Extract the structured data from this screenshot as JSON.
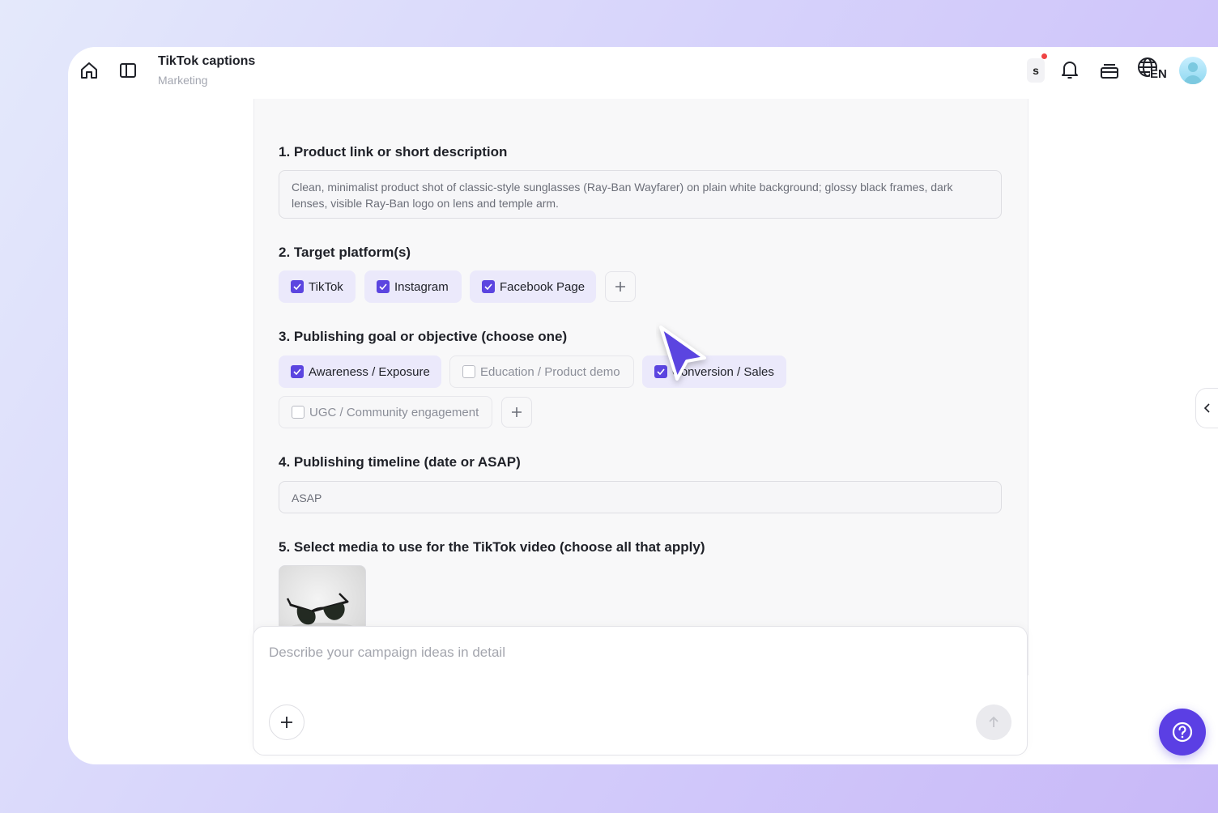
{
  "header": {
    "title": "TikTok captions",
    "subtitle": "Marketing",
    "credits_fragment": "s",
    "language": "EN"
  },
  "form": {
    "q1": {
      "label": "1. Product link or short description",
      "value": "Clean, minimalist product shot of classic-style sunglasses (Ray-Ban Wayfarer) on plain white background; glossy black frames, dark lenses, visible Ray-Ban logo on lens and temple arm."
    },
    "q2": {
      "label": "2. Target platform(s)",
      "options": [
        {
          "label": "TikTok",
          "checked": true
        },
        {
          "label": "Instagram",
          "checked": true
        },
        {
          "label": "Facebook Page",
          "checked": true
        }
      ]
    },
    "q3": {
      "label": "3. Publishing goal or objective (choose one)",
      "options": [
        {
          "label": "Awareness / Exposure",
          "checked": true
        },
        {
          "label": "Education / Product demo",
          "checked": false
        },
        {
          "label": "Conversion / Sales",
          "checked": true
        },
        {
          "label": "UGC / Community engagement",
          "checked": false
        }
      ]
    },
    "q4": {
      "label": "4. Publishing timeline (date or ASAP)",
      "value": "ASAP"
    },
    "q5": {
      "label": "5. Select media to use for the TikTok video (choose all that apply)",
      "media": [
        {
          "icon": "sunglasses-photo"
        }
      ]
    }
  },
  "composer": {
    "placeholder": "Describe your campaign ideas in detail"
  },
  "colors": {
    "accent": "#5b45e0",
    "chip_selected_bg": "#ebe9fb",
    "help_button": "#5b3fe4",
    "notification_dot": "#ef4444"
  }
}
